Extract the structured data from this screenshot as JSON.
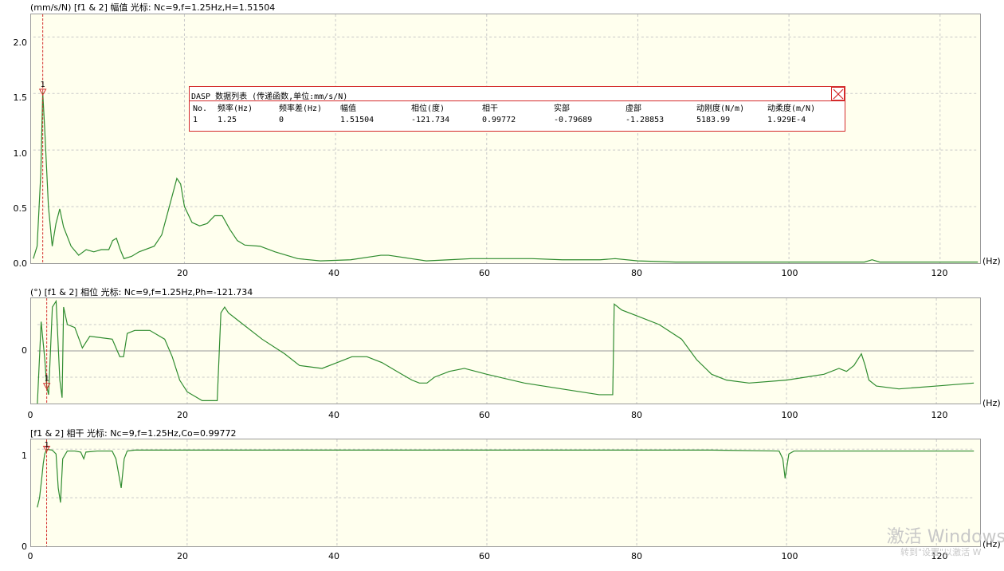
{
  "panels": [
    {
      "title": "(mm/s/N)  [f1 & 2]  幅值  光标: Nc=9,f=1.25Hz,H=1.51504",
      "y_ticks": [
        "2.0",
        "1.5",
        "1.0",
        "0.5",
        "0.0"
      ],
      "x_ticks": [
        "20",
        "40",
        "60",
        "80",
        "100",
        "120"
      ],
      "x_unit": "(Hz)",
      "cursor_label": "1"
    },
    {
      "title": "(°)  [f1 & 2]  相位  光标: Nc=9,f=1.25Hz,Ph=-121.734",
      "y_ticks": [
        "0"
      ],
      "x_ticks": [
        "0",
        "20",
        "40",
        "60",
        "80",
        "100",
        "120"
      ],
      "x_unit": "(Hz)",
      "cursor_label": "1"
    },
    {
      "title": "[f1 & 2]  相干  光标: Nc=9,f=1.25Hz,Co=0.99772",
      "y_ticks": [
        "1",
        "0"
      ],
      "x_ticks": [
        "0",
        "20",
        "40",
        "60",
        "80",
        "100",
        "120"
      ],
      "x_unit": "(Hz)",
      "cursor_label": "1"
    }
  ],
  "data_table": {
    "title": "DASP  数据列表 (传递函数,单位:mm/s/N)",
    "headers": [
      "No.",
      "频率(Hz)",
      "频率差(Hz)",
      "幅值",
      "相位(度)",
      "相干",
      "实部",
      "虚部",
      "动刚度(N/m)",
      "动柔度(m/N)"
    ],
    "row": [
      "1",
      "1.25",
      "0",
      "1.51504",
      "-121.734",
      "0.99772",
      "-0.79689",
      "-1.28853",
      "5183.99",
      "1.929E-4"
    ]
  },
  "watermark": {
    "line1": "激活 Windows",
    "line2": "转到\"设置\"以激活 W"
  },
  "colors": {
    "plot_bg": "#ffffee",
    "curve": "#2e8b2e",
    "cursor": "#d42a2a",
    "grid": "#c8c8c8",
    "table_border": "#d42a2a"
  },
  "chart_data": [
    {
      "type": "line",
      "title": "(mm/s/N)  [f1 & 2]  幅值  光标: Nc=9,f=1.25Hz,H=1.51504",
      "xlabel": "(Hz)",
      "ylabel": "(mm/s/N)",
      "xlim": [
        0,
        125
      ],
      "ylim": [
        0,
        2.2
      ],
      "grid": true,
      "cursor_x": 1.25,
      "series": [
        {
          "x": [
            0,
            0.5,
            1.0,
            1.25,
            1.5,
            2,
            2.5,
            3,
            3.5,
            4,
            5,
            6,
            7,
            8,
            9,
            10,
            10.5,
            11,
            11.5,
            12,
            13,
            14,
            16,
            17,
            18,
            19,
            19.5,
            20,
            21,
            22,
            23,
            24,
            25,
            26,
            27,
            28,
            30,
            32,
            35,
            38,
            42,
            46,
            47,
            50,
            52,
            55,
            58,
            62,
            66,
            70,
            75,
            77,
            80,
            85,
            90,
            95,
            100,
            105,
            110,
            111,
            112,
            115,
            120,
            125
          ],
          "y": [
            0.04,
            0.15,
            0.8,
            1.51,
            1.2,
            0.5,
            0.15,
            0.35,
            0.48,
            0.32,
            0.15,
            0.07,
            0.12,
            0.1,
            0.12,
            0.12,
            0.2,
            0.22,
            0.12,
            0.04,
            0.06,
            0.1,
            0.15,
            0.25,
            0.5,
            0.75,
            0.7,
            0.5,
            0.36,
            0.33,
            0.35,
            0.42,
            0.42,
            0.3,
            0.2,
            0.16,
            0.15,
            0.1,
            0.04,
            0.02,
            0.03,
            0.07,
            0.07,
            0.04,
            0.02,
            0.03,
            0.04,
            0.04,
            0.04,
            0.03,
            0.03,
            0.04,
            0.02,
            0.01,
            0.01,
            0.01,
            0.01,
            0.01,
            0.01,
            0.03,
            0.01,
            0.01,
            0.01,
            0.01
          ]
        }
      ]
    },
    {
      "type": "line",
      "title": "(°)  [f1 & 2]  相位  光标: Nc=9,f=1.25Hz,Ph=-121.734",
      "xlabel": "(Hz)",
      "ylabel": "(°)",
      "xlim": [
        0,
        125
      ],
      "ylim": [
        -180,
        180
      ],
      "grid": true,
      "cursor_x": 1.25,
      "series": [
        {
          "x": [
            0,
            0.5,
            1.0,
            1.25,
            1.5,
            2,
            2.5,
            3,
            3.3,
            3.5,
            4,
            5,
            6,
            7,
            10,
            11,
            11.5,
            12,
            13,
            15,
            17,
            18,
            19,
            20,
            22,
            24,
            24.5,
            25,
            25.5,
            27,
            30,
            33,
            35,
            38,
            40,
            42,
            44,
            46,
            48,
            50,
            51,
            52,
            53,
            55,
            57,
            60,
            65,
            70,
            75,
            76.8,
            77,
            78,
            80,
            83,
            86,
            88,
            90,
            92,
            95,
            100,
            105,
            107,
            108,
            109,
            110,
            110.5,
            111,
            112,
            115,
            120,
            125
          ],
          "y": [
            -180,
            100,
            -30,
            -121.7,
            -150,
            150,
            170,
            -100,
            -160,
            150,
            90,
            80,
            10,
            50,
            40,
            -20,
            -20,
            60,
            70,
            70,
            40,
            -20,
            -100,
            -140,
            -170,
            -170,
            130,
            150,
            130,
            100,
            40,
            -10,
            -50,
            -60,
            -40,
            -20,
            -20,
            -40,
            -70,
            -100,
            -110,
            -110,
            -90,
            -70,
            -60,
            -80,
            -110,
            -130,
            -150,
            -150,
            160,
            140,
            120,
            90,
            40,
            -30,
            -80,
            -100,
            -110,
            -100,
            -80,
            -60,
            -70,
            -50,
            -10,
            -50,
            -100,
            -120,
            -130,
            -120,
            -110
          ]
        }
      ]
    },
    {
      "type": "line",
      "title": "[f1 & 2]  相干  光标: Nc=9,f=1.25Hz,Co=0.99772",
      "xlabel": "(Hz)",
      "ylabel": "",
      "xlim": [
        0,
        125
      ],
      "ylim": [
        0,
        1.1
      ],
      "grid": true,
      "cursor_x": 1.25,
      "series": [
        {
          "x": [
            0,
            0.3,
            0.6,
            0.8,
            1.0,
            1.25,
            2,
            2.5,
            2.8,
            3.1,
            3.4,
            4,
            5,
            5.8,
            6.2,
            6.5,
            8,
            10,
            10.5,
            11.2,
            11.6,
            12,
            13,
            20,
            40,
            60,
            80,
            90,
            99,
            99.5,
            99.8,
            100,
            100.3,
            101,
            110,
            120,
            125
          ],
          "y": [
            0.4,
            0.5,
            0.7,
            0.85,
            0.95,
            0.998,
            0.99,
            0.95,
            0.6,
            0.45,
            0.9,
            0.98,
            0.98,
            0.97,
            0.9,
            0.97,
            0.98,
            0.98,
            0.9,
            0.6,
            0.9,
            0.98,
            0.99,
            0.99,
            0.99,
            0.99,
            0.99,
            0.99,
            0.98,
            0.9,
            0.7,
            0.8,
            0.95,
            0.98,
            0.98,
            0.98,
            0.98
          ]
        }
      ]
    }
  ]
}
